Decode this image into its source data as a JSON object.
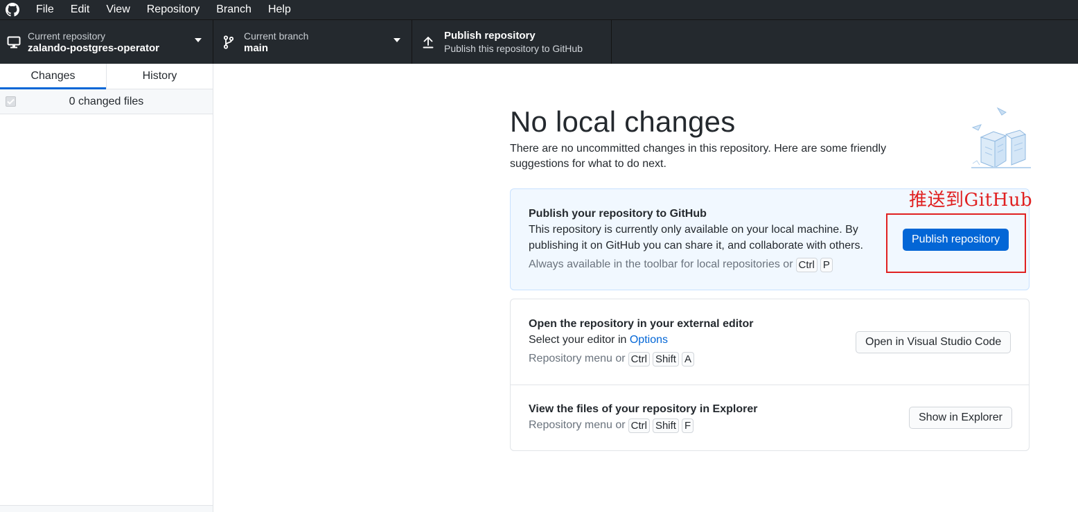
{
  "menubar": {
    "items": [
      "File",
      "Edit",
      "View",
      "Repository",
      "Branch",
      "Help"
    ]
  },
  "toolbar": {
    "repo": {
      "label": "Current repository",
      "value": "zalando-postgres-operator"
    },
    "branch": {
      "label": "Current branch",
      "value": "main"
    },
    "publish": {
      "title": "Publish repository",
      "subtitle": "Publish this repository to GitHub"
    }
  },
  "sidebar": {
    "tabs": [
      "Changes",
      "History"
    ],
    "selected_tab": "Changes",
    "changed_files": "0 changed files"
  },
  "main": {
    "heading": "No local changes",
    "subtext": "There are no uncommitted changes in this repository. Here are some friendly suggestions for what to do next.",
    "publish_card": {
      "title": "Publish your repository to GitHub",
      "desc": "This repository is currently only available on your local machine. By publishing it on GitHub you can share it, and collaborate with others.",
      "hint": "Always available in the toolbar for local repositories or",
      "keys": [
        "Ctrl",
        "P"
      ],
      "button": "Publish repository"
    },
    "editor_card": {
      "title": "Open the repository in your external editor",
      "desc_prefix": "Select your editor in",
      "desc_link": "Options",
      "hint": "Repository menu or",
      "keys": [
        "Ctrl",
        "Shift",
        "A"
      ],
      "button": "Open in Visual Studio Code"
    },
    "explorer_card": {
      "title": "View the files of your repository in Explorer",
      "hint": "Repository menu or",
      "keys": [
        "Ctrl",
        "Shift",
        "F"
      ],
      "button": "Show in Explorer"
    }
  },
  "annotation": {
    "text": "推送到GitHub",
    "color": "#e02020"
  },
  "colors": {
    "toolbar_bg": "#24292e",
    "accent": "#0366d6",
    "publish_card_bg": "#f1f8ff"
  }
}
